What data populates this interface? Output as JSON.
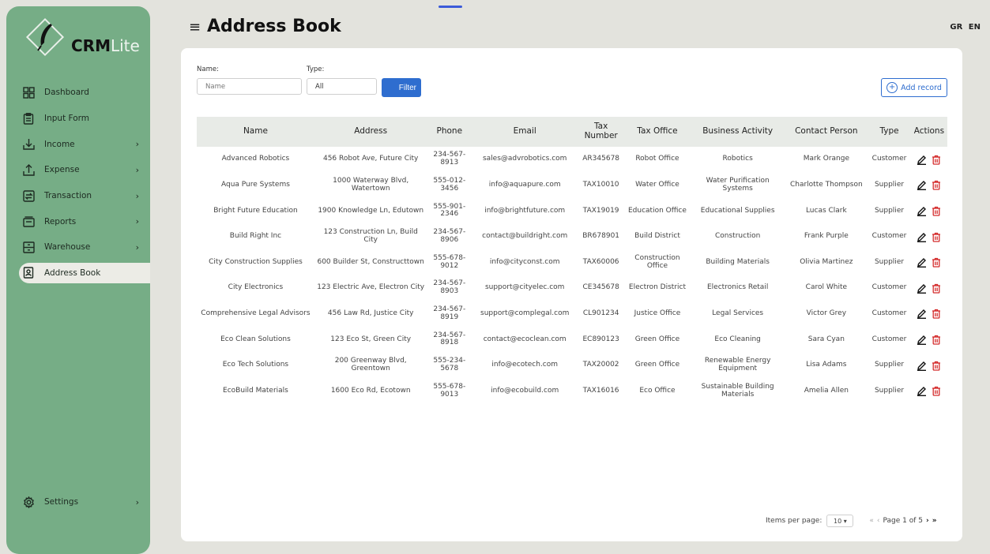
{
  "brand": {
    "bold": "CRM",
    "light": "Lite"
  },
  "header": {
    "title": "Address Book",
    "lang_gr": "GR",
    "lang_en": "EN"
  },
  "sidebar": {
    "items": [
      {
        "label": "Dashboard",
        "icon": "dashboard-icon",
        "chevron": ""
      },
      {
        "label": "Input Form",
        "icon": "clipboard-icon",
        "chevron": ""
      },
      {
        "label": "Income",
        "icon": "download-icon",
        "chevron": "›"
      },
      {
        "label": "Expense",
        "icon": "upload-icon",
        "chevron": "›"
      },
      {
        "label": "Transaction",
        "icon": "transaction-icon",
        "chevron": "›"
      },
      {
        "label": "Reports",
        "icon": "reports-icon",
        "chevron": "›"
      },
      {
        "label": "Warehouse",
        "icon": "warehouse-icon",
        "chevron": "›"
      },
      {
        "label": "Address Book",
        "icon": "contact-icon",
        "chevron": ""
      }
    ],
    "settings": {
      "label": "Settings",
      "icon": "gear-icon",
      "chevron": "›"
    }
  },
  "filters": {
    "name_label": "Name:",
    "name_placeholder": "Name",
    "type_label": "Type:",
    "type_value": "All",
    "filter_button": "Filter",
    "add_button": "Add record"
  },
  "table": {
    "headers": [
      "Name",
      "Address",
      "Phone",
      "Email",
      "Tax Number",
      "Tax Office",
      "Business Activity",
      "Contact Person",
      "Type",
      "Actions"
    ],
    "rows": [
      [
        "Advanced Robotics",
        "456 Robot Ave, Future City",
        "234-567-8913",
        "sales@advrobotics.com",
        "AR345678",
        "Robot Office",
        "Robotics",
        "Mark Orange",
        "Customer"
      ],
      [
        "Aqua Pure Systems",
        "1000 Waterway Blvd, Watertown",
        "555-012-3456",
        "info@aquapure.com",
        "TAX10010",
        "Water Office",
        "Water Purification Systems",
        "Charlotte Thompson",
        "Supplier"
      ],
      [
        "Bright Future Education",
        "1900 Knowledge Ln, Edutown",
        "555-901-2346",
        "info@brightfuture.com",
        "TAX19019",
        "Education Office",
        "Educational Supplies",
        "Lucas Clark",
        "Supplier"
      ],
      [
        "Build Right Inc",
        "123 Construction Ln, Build City",
        "234-567-8906",
        "contact@buildright.com",
        "BR678901",
        "Build District",
        "Construction",
        "Frank Purple",
        "Customer"
      ],
      [
        "City Construction Supplies",
        "600 Builder St, Constructtown",
        "555-678-9012",
        "info@cityconst.com",
        "TAX60006",
        "Construction Office",
        "Building Materials",
        "Olivia Martinez",
        "Supplier"
      ],
      [
        "City Electronics",
        "123 Electric Ave, Electron City",
        "234-567-8903",
        "support@cityelec.com",
        "CE345678",
        "Electron District",
        "Electronics Retail",
        "Carol White",
        "Customer"
      ],
      [
        "Comprehensive Legal Advisors",
        "456 Law Rd, Justice City",
        "234-567-8919",
        "support@complegal.com",
        "CL901234",
        "Justice Office",
        "Legal Services",
        "Victor Grey",
        "Customer"
      ],
      [
        "Eco Clean Solutions",
        "123 Eco St, Green City",
        "234-567-8918",
        "contact@ecoclean.com",
        "EC890123",
        "Green Office",
        "Eco Cleaning",
        "Sara Cyan",
        "Customer"
      ],
      [
        "Eco Tech Solutions",
        "200 Greenway Blvd, Greentown",
        "555-234-5678",
        "info@ecotech.com",
        "TAX20002",
        "Green Office",
        "Renewable Energy Equipment",
        "Lisa Adams",
        "Supplier"
      ],
      [
        "EcoBuild Materials",
        "1600 Eco Rd, Ecotown",
        "555-678-9013",
        "info@ecobuild.com",
        "TAX16016",
        "Eco Office",
        "Sustainable Building Materials",
        "Amelia Allen",
        "Supplier"
      ]
    ]
  },
  "pagination": {
    "items_label": "Items per page:",
    "per_page": "10 ▾",
    "first": "«",
    "prev": "‹",
    "page_text": "Page 1 of 5",
    "next": "›",
    "last": "»"
  },
  "colors": {
    "sidebar": "#76ad86",
    "accent": "#2e6dcf",
    "delete": "#d42b2b"
  }
}
